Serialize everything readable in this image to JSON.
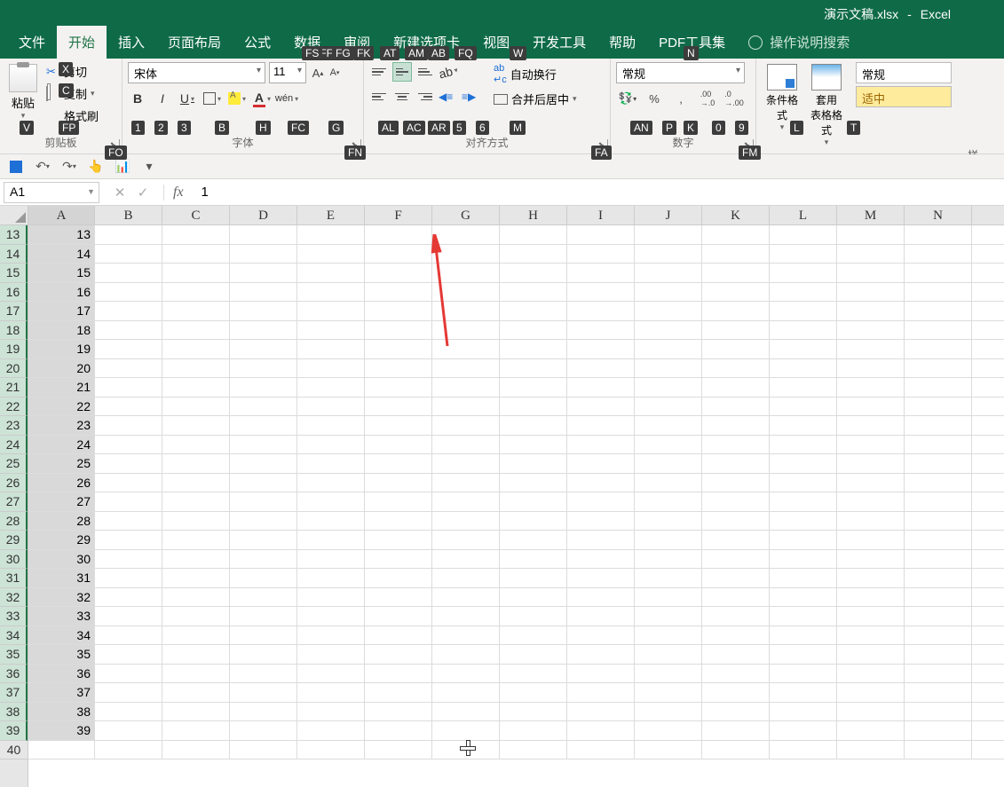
{
  "title": {
    "filename": "演示文稿.xlsx",
    "sep": "-",
    "app": "Excel"
  },
  "tabs": {
    "file": "文件",
    "home": "开始",
    "insert": "插入",
    "layout": "页面布局",
    "formulas": "公式",
    "data": "数据",
    "review": "审阅",
    "newtab": "新建选项卡",
    "view": "视图",
    "dev": "开发工具",
    "help": "帮助",
    "pdf": "PDF工具集",
    "tellme": "操作说明搜索"
  },
  "clipboard": {
    "paste": "粘贴",
    "cut": "剪切",
    "copy": "复制",
    "painter": "格式刷",
    "label": "剪贴板"
  },
  "font": {
    "name": "宋体",
    "size": "11",
    "label": "字体",
    "grow": "A",
    "shrink": "A",
    "bold": "B",
    "italic": "I",
    "underline": "U",
    "color": "A",
    "phon": "wén"
  },
  "align": {
    "wrap": "自动换行",
    "merge": "合并后居中",
    "label": "对齐方式"
  },
  "number": {
    "format": "常规",
    "label": "数字",
    "pct": "%",
    "comma": ",",
    "curr": "$"
  },
  "styles": {
    "cond": "条件格式",
    "table": "套用\n表格格式",
    "normal": "常规",
    "mid": "适中",
    "label": "样"
  },
  "keytips": {
    "x": "X",
    "c": "C",
    "v": "V",
    "fp": "FP",
    "fo": "FO",
    "ff": "FF",
    "fs": "FS",
    "fg": "FG",
    "fk": "FK",
    "one": "1",
    "two": "2",
    "three": "3",
    "b": "B",
    "h": "H",
    "fc": "FC",
    "g": "G",
    "fn": "FN",
    "at": "AT",
    "am": "AM",
    "ab": "AB",
    "fq": "FQ",
    "al": "AL",
    "ac": "AC",
    "ar": "AR",
    "five": "5",
    "six": "6",
    "w": "W",
    "m": "M",
    "fa": "FA",
    "n": "N",
    "an": "AN",
    "p": "P",
    "k": "K",
    "zero": "0",
    "nine": "9",
    "fm": "FM",
    "l": "L",
    "t": "T"
  },
  "namebox": "A1",
  "formula": "1",
  "columns": [
    "A",
    "B",
    "C",
    "D",
    "E",
    "F",
    "G",
    "H",
    "I",
    "J",
    "K",
    "L",
    "M",
    "N"
  ],
  "rows": [
    13,
    14,
    15,
    16,
    17,
    18,
    19,
    20,
    21,
    22,
    23,
    24,
    25,
    26,
    27,
    28,
    29,
    30,
    31,
    32,
    33,
    34,
    35,
    36,
    37,
    38,
    39,
    40
  ],
  "colA_values": [
    13,
    14,
    15,
    16,
    17,
    18,
    19,
    20,
    21,
    22,
    23,
    24,
    25,
    26,
    27,
    28,
    29,
    30,
    31,
    32,
    33,
    34,
    35,
    36,
    37,
    38,
    39,
    ""
  ]
}
